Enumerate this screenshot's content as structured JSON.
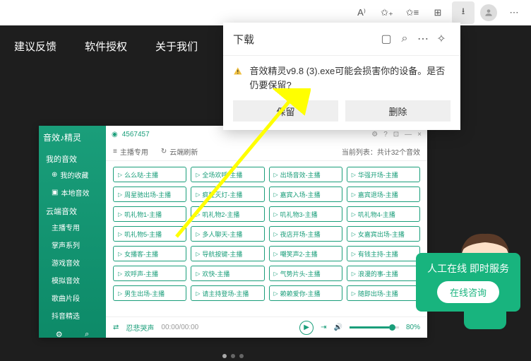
{
  "browser": {
    "read_aloud": "A⁾",
    "zoom_default": false
  },
  "download": {
    "title": "下载",
    "message": "音效精灵v9.8 (3).exe可能会损害你的设备。是否仍要保留?",
    "keep": "保留",
    "delete": "删除"
  },
  "nav": {
    "feedback": "建议反馈",
    "license": "软件授权",
    "about": "关于我们"
  },
  "app": {
    "logo": "音效♪精灵",
    "user_id": "4567457",
    "side": {
      "my_sounds": "我的音效",
      "favorites": "我的收藏",
      "local": "本地音效",
      "cloud_sounds": "云端音效",
      "items": [
        "主播专用",
        "掌声系列",
        "游戏音效",
        "模拟音效",
        "歌曲片段",
        "抖音精选"
      ]
    },
    "toolbar": {
      "tab1": "主播专用",
      "tab2": "云端刷新",
      "count": "当前列表：共计32个音效"
    },
    "grid": [
      "么么哒-主播",
      "全场欢呼-主播",
      "出场音效-主播",
      "华强开场-主播",
      "周星驰出场-主播",
      "疯狂灭灯-主播",
      "嘉宾入场-主播",
      "嘉宾退场-主播",
      "叽礼物1-主播",
      "叽礼物2-主播",
      "叽礼物3-主播",
      "叽礼物4-主播",
      "叽礼物5-主播",
      "多人聊天-主播",
      "夜店开场-主播",
      "女嘉宾出场-主播",
      "女播客-主播",
      "导航按键-主播",
      "嘲笑声2-主播",
      "有钱主持-主播",
      "欢呼声-主播",
      "欢快-主播",
      "气势片头-主播",
      "浪漫的事-主播",
      "男生出场-主播",
      "请主持登场-主播",
      "赖赖爱你-主播",
      "随即出场-主播"
    ],
    "player": {
      "track": "忍悲哭声",
      "time": "00:00/00:00",
      "volume": "80%"
    }
  },
  "chat": {
    "text": "人工在线 即时服务",
    "button": "在线咨询"
  }
}
